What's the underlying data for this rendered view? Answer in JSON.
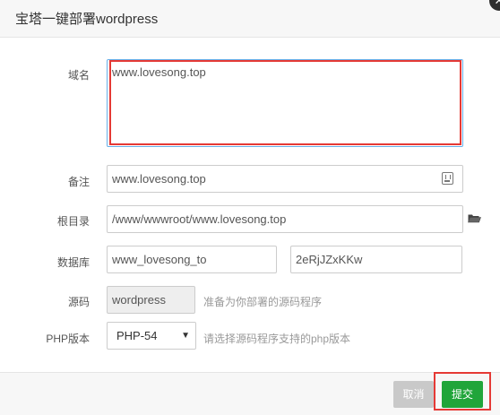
{
  "dialog": {
    "title": "宝塔一键部署wordpress"
  },
  "form": {
    "domain_label": "域名",
    "domain_value": "www.lovesong.top",
    "note_label": "备注",
    "note_value": "www.lovesong.top",
    "root_label": "根目录",
    "root_value": "/www/wwwroot/www.lovesong.top",
    "db_label": "数据库",
    "db_name": "www_lovesong_to",
    "db_password": "2eRjJZxKKw",
    "source_label": "源码",
    "source_value": "wordpress",
    "source_hint": "准备为你部署的源码程序",
    "php_label": "PHP版本",
    "php_selected": "PHP-54",
    "php_hint": "请选择源码程序支持的php版本"
  },
  "footer": {
    "cancel_label": "取消",
    "submit_label": "提交"
  },
  "icons": {
    "close": "close-icon",
    "note": "note-icon",
    "folder": "folder-open-icon",
    "dropdown": "chevron-down-icon"
  },
  "colors": {
    "primary": "#20a53a",
    "highlight": "#e53935",
    "focus_border": "#66afe9",
    "cancel": "#c9c9c9"
  }
}
